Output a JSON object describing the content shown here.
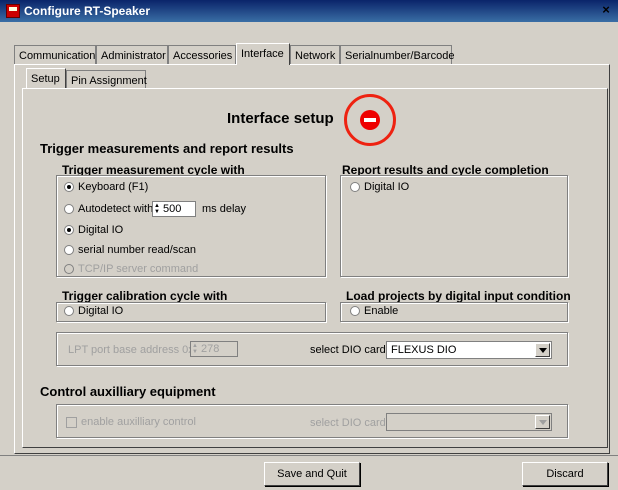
{
  "window": {
    "title": "Configure RT-Speaker",
    "close_label": "×"
  },
  "tabs": [
    "Communication",
    "Administrator",
    "Accessories",
    "Interface",
    "Network",
    "Serialnumber/Barcode"
  ],
  "active_tab": "Interface",
  "subtabs": [
    "Setup",
    "Pin Assignment"
  ],
  "active_subtab": "Setup",
  "heading": "Interface setup",
  "trigger_section": {
    "title": "Trigger measurements and report results",
    "cycle_group": {
      "title": "Trigger measurement cycle with",
      "options": {
        "keyboard": "Keyboard   (F1)",
        "autodetect_prefix": "Autodetect with",
        "autodetect_value": "500",
        "autodetect_suffix": "ms delay",
        "digital_io": "Digital IO",
        "serial": "serial number read/scan",
        "tcp": "TCP/IP server command"
      },
      "selected": [
        "keyboard",
        "digital_io"
      ]
    },
    "report_group": {
      "title": "Report results and cycle completion",
      "option": "Digital IO"
    },
    "calibration_group": {
      "title": "Trigger calibration cycle with",
      "option": "Digital IO"
    },
    "load_group": {
      "title": "Load projects by digital input condition",
      "option": "Enable"
    },
    "lpt": {
      "label": "LPT port base address 0x",
      "value": "278"
    },
    "dio": {
      "label": "select DIO card",
      "value": "FLEXUS DIO"
    }
  },
  "aux_section": {
    "title": "Control auxilliary equipment",
    "enable_label": "enable auxilliary control",
    "dio_label": "select DIO card",
    "dio_value": ""
  },
  "buttons": {
    "save": "Save and Quit",
    "discard": "Discard"
  },
  "colors": {
    "titlebar": "#0a246a",
    "background": "#d4d0c8",
    "annotation": "#e21"
  }
}
